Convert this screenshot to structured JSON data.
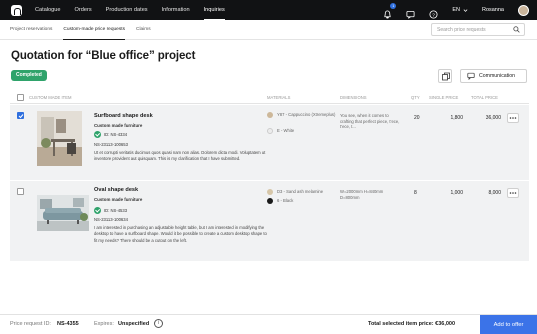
{
  "nav": {
    "items": [
      "Catalogue",
      "Orders",
      "Production dates",
      "Information",
      "Inquiries"
    ],
    "active": "Inquiries",
    "notification_count": "1",
    "language": "EN",
    "user_name": "Rosanna"
  },
  "subnav": {
    "tabs": [
      "Project reservations",
      "Custom-made price requests",
      "Claims"
    ],
    "active": "Custom-made price requests",
    "search_placeholder": "Search price requests"
  },
  "page": {
    "title": "Quotation for “Blue office” project",
    "status": "Completed",
    "communication_label": "Communication"
  },
  "table": {
    "headers": {
      "item": "CUSTOM MADE ITEM",
      "materials": "MATERIALS",
      "dimensions": "DIMENSIONS",
      "qty": "QTY",
      "single_price": "SINGLE PRICE",
      "total_price": "TOTAL PRICE"
    },
    "rows": [
      {
        "checked": true,
        "name": "Surfboard shape desk",
        "type": "Custom made furniture",
        "id": "ID: NS-4334",
        "ns": "NS-23113-100653",
        "description": "Ut et corrupti veritatis ducimus quos quasi nam non alias. Dolorem dicta modi. Voluptatem ut inventore provident aut quisquam. This is my clarification that I have submitted.",
        "materials": [
          {
            "label": "Y87 - Cappuccino (Xtremeplus)",
            "color": "#cdb89a"
          },
          {
            "label": "E - White",
            "color": "#ececec"
          }
        ],
        "dimensions": "You see, when it comes to crafting that perfect piece, t’ece, t’ece, t...",
        "qty": "20",
        "single_price": "1,800",
        "total_price": "36,000"
      },
      {
        "checked": false,
        "name": "Oval shape desk",
        "type": "Custom made furniture",
        "id": "ID: NS-4533",
        "ns": "NS-23113-100634",
        "description": "I am interested in purchasing an adjustable height table, but I am interested in modifying the desktop to have a surfboard shape. Would it be possible to create a custom desktop shape to fit my needs? There should be a cutout on the left.",
        "materials": [
          {
            "label": "D3 - Sand ash melamine",
            "color": "#d6c6a8"
          },
          {
            "label": "6 - Black",
            "color": "#1a1a1a"
          }
        ],
        "dimensions": "W=2000mm H=840mm D=800mm",
        "qty": "8",
        "single_price": "1,000",
        "total_price": "8,000"
      }
    ]
  },
  "footer": {
    "request_id_label": "Price request ID:",
    "request_id_value": "NS-4355",
    "expires_label": "Expires:",
    "expires_value": "Unspecified",
    "total_label": "Total selected item price: €36,000",
    "add_button": "Add to offer"
  },
  "colors": {
    "topbar": "#111214",
    "status_green": "#2fa36b",
    "accent_blue": "#3b73e8"
  }
}
